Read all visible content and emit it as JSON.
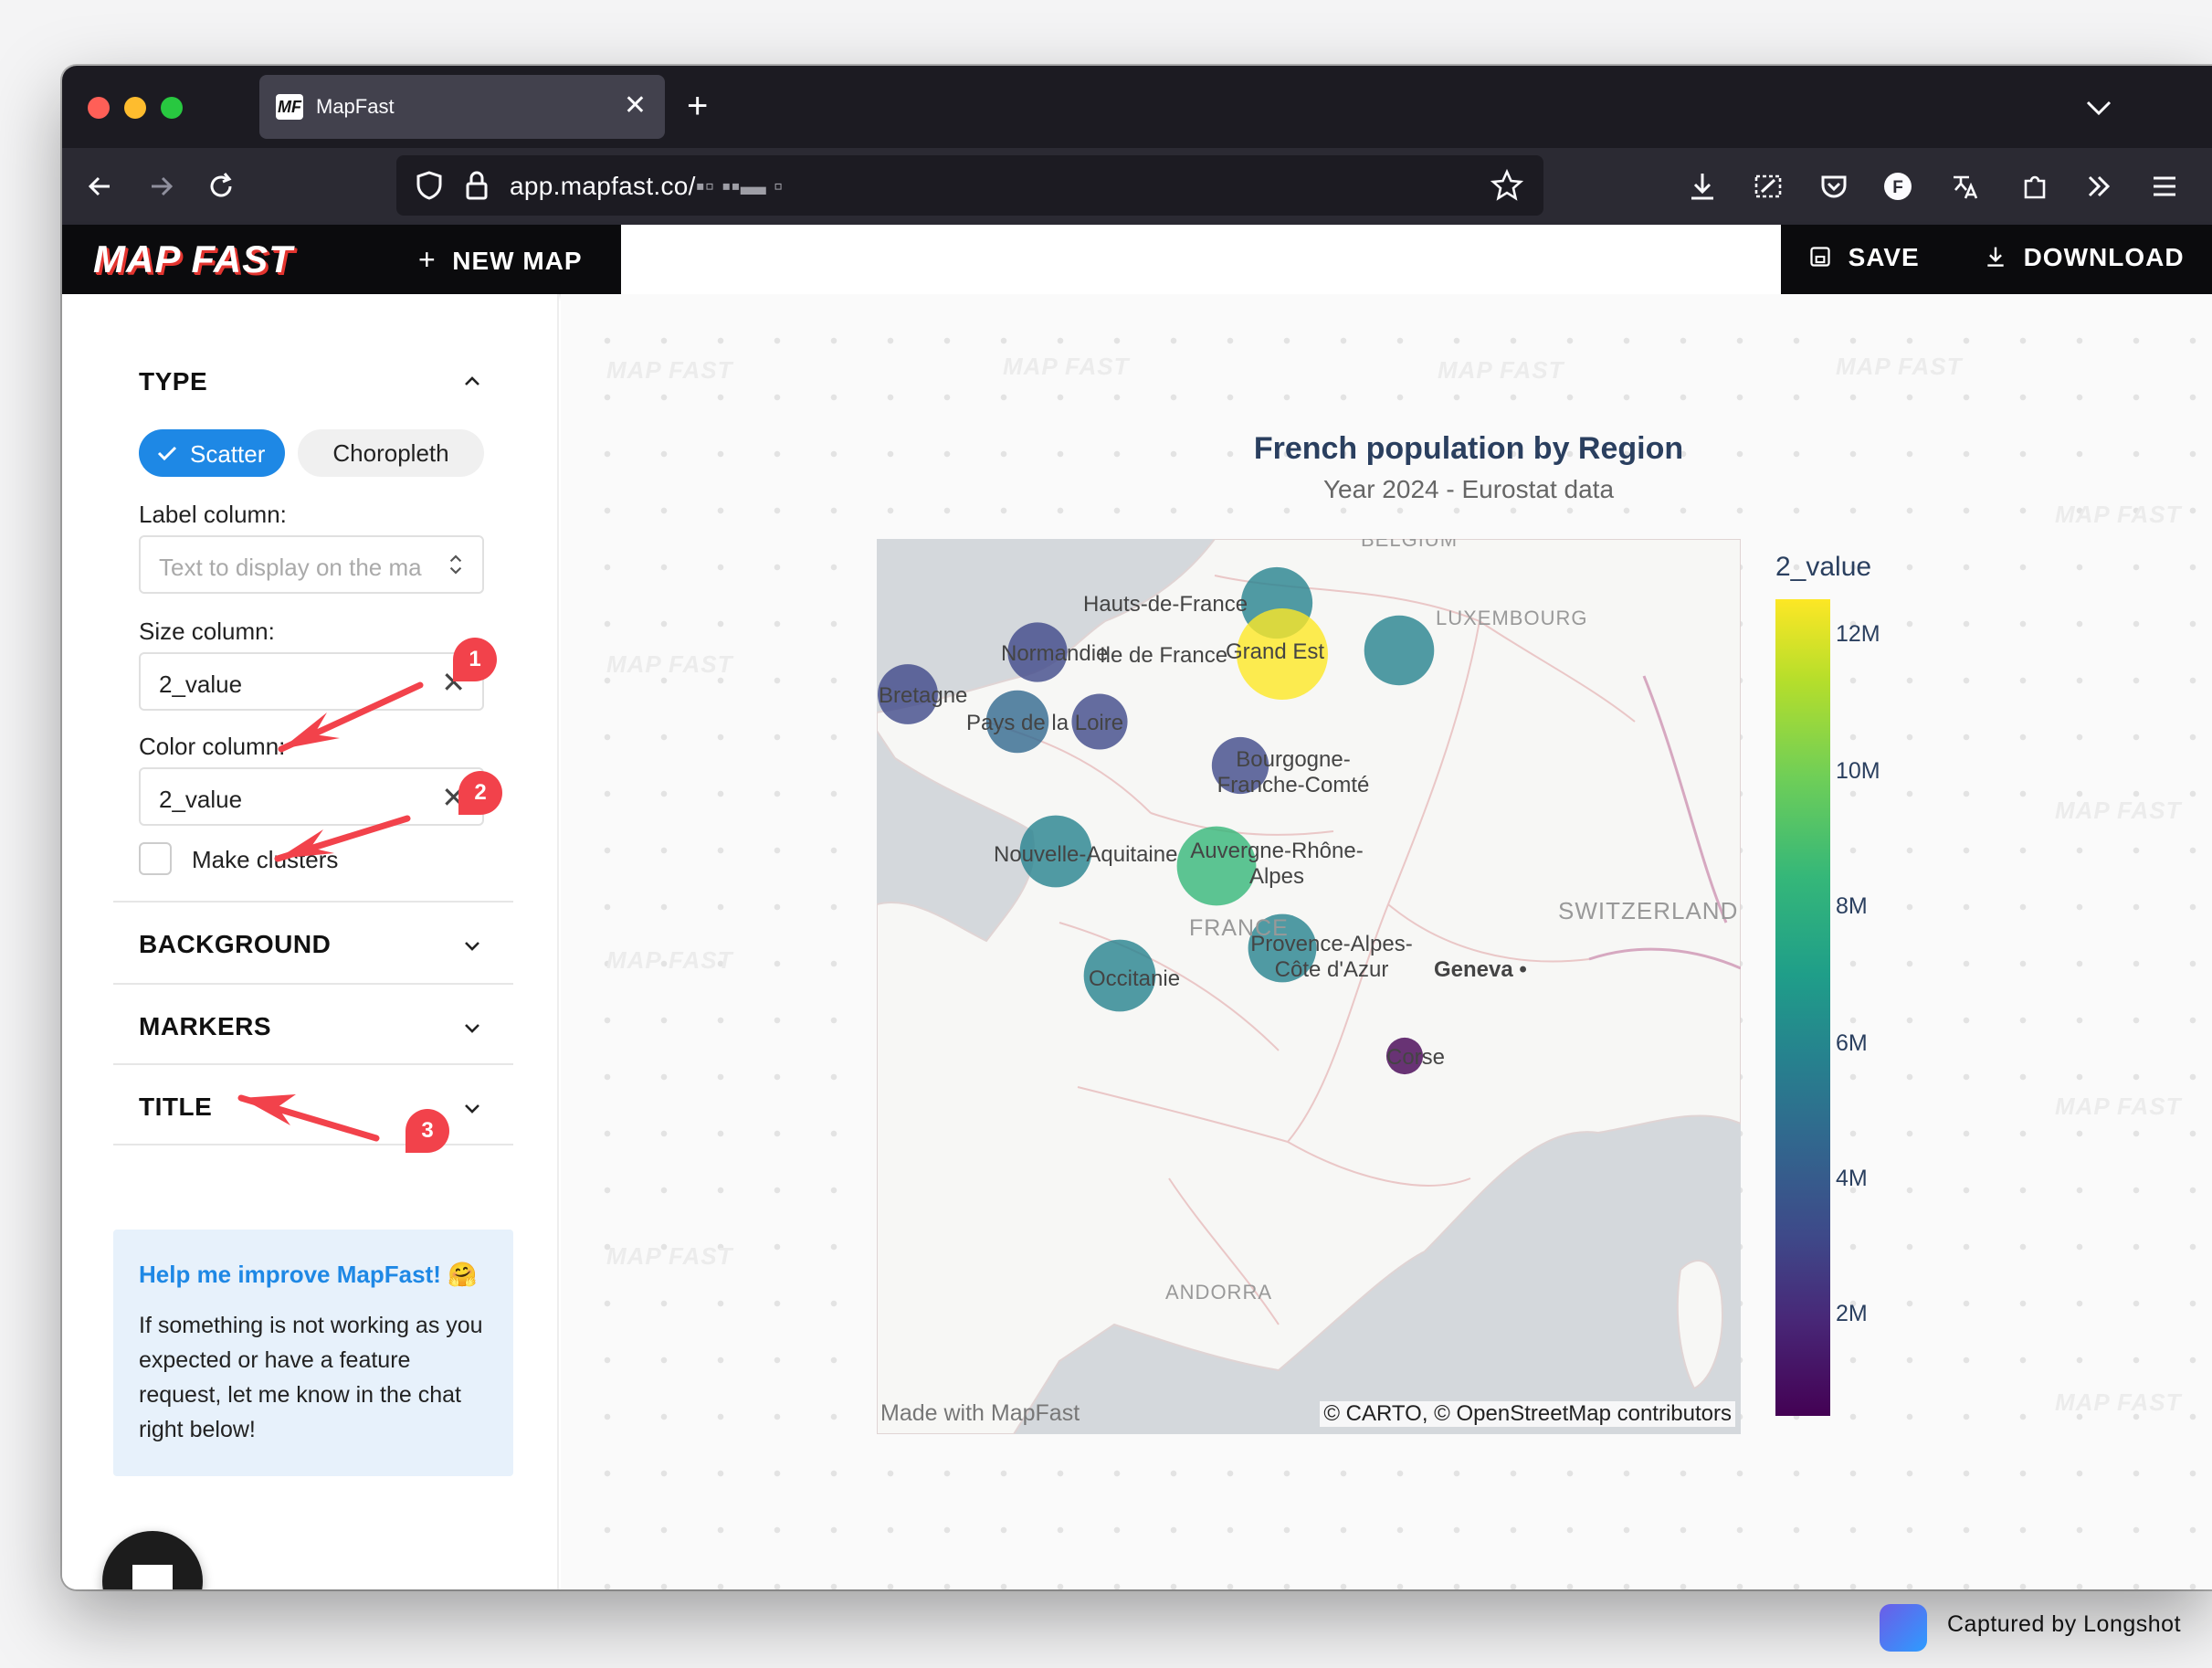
{
  "browser": {
    "tab_title": "MapFast",
    "tab_icon": "MF",
    "url_domain": "app.mapfast.co/",
    "url_path": "▪▫ ▪▪▬ ▫",
    "profile_initial": "F"
  },
  "app": {
    "logo_text": "MAP FAST",
    "new_map_label": "NEW MAP",
    "save_label": "SAVE",
    "download_label": "DOWNLOAD"
  },
  "sidebar": {
    "type_heading": "TYPE",
    "type_options": [
      "Scatter",
      "Choropleth"
    ],
    "selected_type": "Scatter",
    "label_column_label": "Label column:",
    "label_column_placeholder": "Text to display on the ma",
    "size_column_label": "Size column:",
    "size_column_value": "2_value",
    "color_column_label": "Color column:",
    "color_column_value": "2_value",
    "make_clusters_label": "Make clusters",
    "make_clusters_checked": false,
    "sections": [
      "BACKGROUND",
      "MARKERS",
      "TITLE"
    ],
    "help_title": "Help me improve MapFast! 🤗",
    "help_body": "If something is not working as you expected or have a feature request, let me know in the chat right below!"
  },
  "annotations": [
    "1",
    "2",
    "3"
  ],
  "watermark": "MAP FAST",
  "map": {
    "title": "French population by Region",
    "subtitle": "Year 2024 - Eurostat data",
    "credit_left": "Made with MapFast",
    "credit_right": "© CARTO, © OpenStreetMap contributors",
    "geo_labels": [
      "BELGIUM",
      "LUXEMBOURG",
      "FRANCE",
      "SWITZERLAND",
      "Geneva",
      "ANDORRA"
    ],
    "colors": {
      "low": "#440154",
      "mid": "#21918c",
      "high": "#fde725"
    }
  },
  "chart_data": {
    "type": "scatter",
    "color_label": "2_value",
    "colorbar_ticks": [
      "12M",
      "10M",
      "8M",
      "6M",
      "4M",
      "2M"
    ],
    "colorbar_range": [
      0,
      13000000
    ],
    "points": [
      {
        "name": "Hauts-de-France",
        "value": 6000000
      },
      {
        "name": "Ile de France",
        "value": 12300000
      },
      {
        "name": "Grand Est",
        "value": 5600000
      },
      {
        "name": "Normandie",
        "value": 3300000
      },
      {
        "name": "Bretagne",
        "value": 3400000
      },
      {
        "name": "Pays de la Loire",
        "value": 3900000
      },
      {
        "name": "",
        "value": 2600000
      },
      {
        "name": "Bourgogne-Franche-Comté",
        "value": 2800000
      },
      {
        "name": "Nouvelle-Aquitaine",
        "value": 6100000
      },
      {
        "name": "Auvergne-Rhône-Alpes",
        "value": 8200000
      },
      {
        "name": "Provence-Alpes-Côte d'Azur",
        "value": 5200000
      },
      {
        "name": "Occitanie",
        "value": 6100000
      },
      {
        "name": "Corse",
        "value": 350000
      }
    ]
  }
}
